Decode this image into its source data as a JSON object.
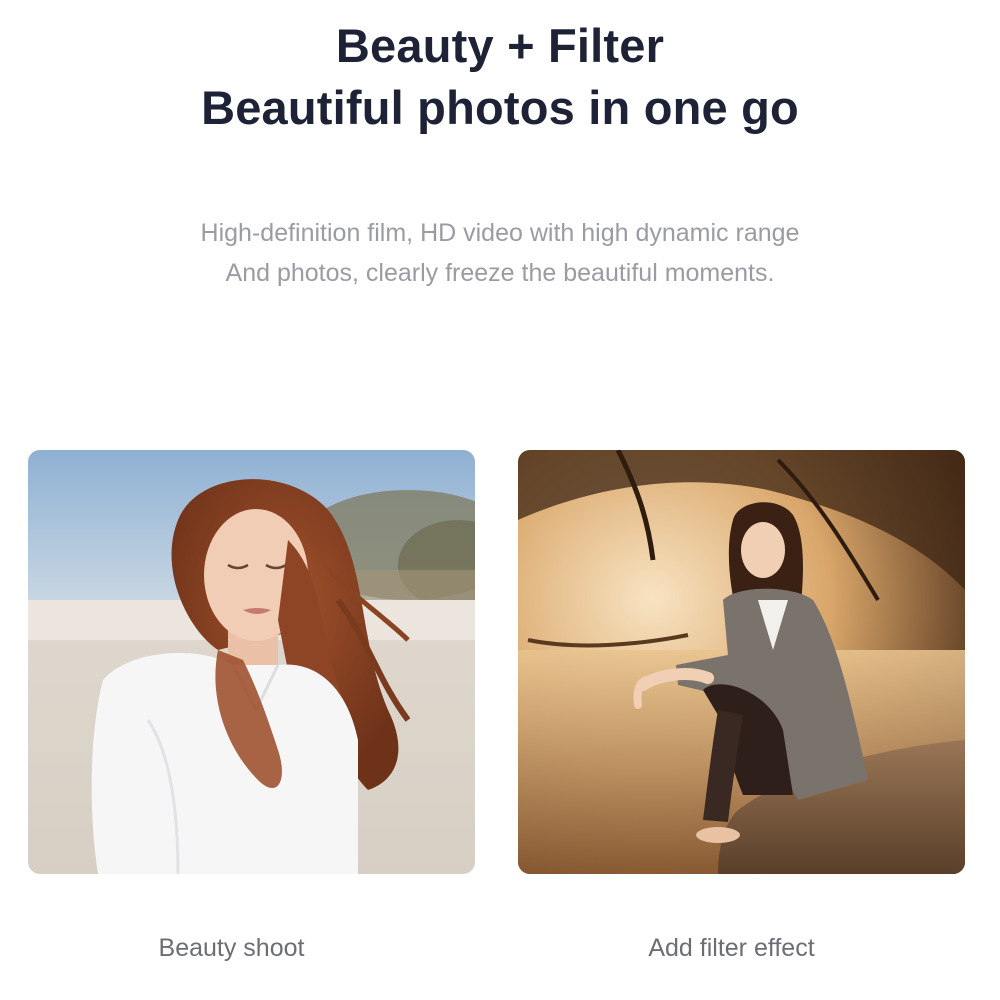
{
  "header": {
    "title_line1": "Beauty + Filter",
    "title_line2": "Beautiful photos in one go"
  },
  "description": {
    "line1": "High-definition film, HD video with high dynamic range",
    "line2": "And photos, clearly freeze the beautiful moments."
  },
  "photos": [
    {
      "caption": "Beauty shoot"
    },
    {
      "caption": "Add filter effect"
    }
  ],
  "colors": {
    "title": "#1d2236",
    "description": "#9a9ca3",
    "caption": "#6c6e75",
    "background": "#ffffff"
  }
}
